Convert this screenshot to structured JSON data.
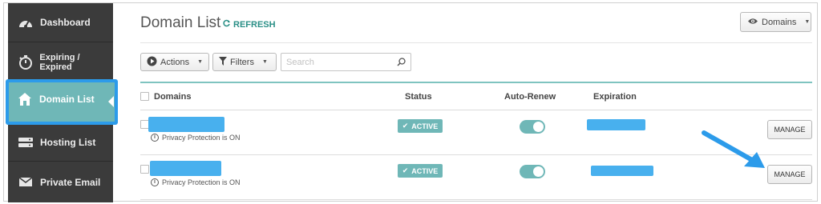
{
  "sidebar": {
    "items": [
      {
        "label": "Dashboard",
        "icon": "dashboard-gauge-icon"
      },
      {
        "label": "Expiring / Expired",
        "icon": "stopwatch-icon"
      },
      {
        "label": "Domain List",
        "icon": "home-icon",
        "active": true
      },
      {
        "label": "Hosting List",
        "icon": "server-icon"
      },
      {
        "label": "Private Email",
        "icon": "envelope-icon"
      }
    ]
  },
  "header": {
    "title": "Domain List",
    "refresh_label": "REFRESH",
    "view_button_label": "Domains"
  },
  "toolbar": {
    "actions_label": "Actions",
    "filters_label": "Filters",
    "search_placeholder": "Search"
  },
  "table": {
    "columns": [
      "Domains",
      "Status",
      "Auto-Renew",
      "Expiration"
    ],
    "rows": [
      {
        "domain": "",
        "privacy": "Privacy Protection is ON",
        "status": "ACTIVE",
        "auto_renew": true,
        "expiration": "",
        "action": "MANAGE"
      },
      {
        "domain": "",
        "privacy": "Privacy Protection is ON",
        "status": "ACTIVE",
        "auto_renew": true,
        "expiration": "",
        "action": "MANAGE"
      }
    ]
  },
  "colors": {
    "sidebar_bg": "#3b3b3b",
    "accent_teal": "#6fb7b7",
    "highlight_blue": "#2c9bea",
    "redaction_blue": "#48b0ee"
  }
}
